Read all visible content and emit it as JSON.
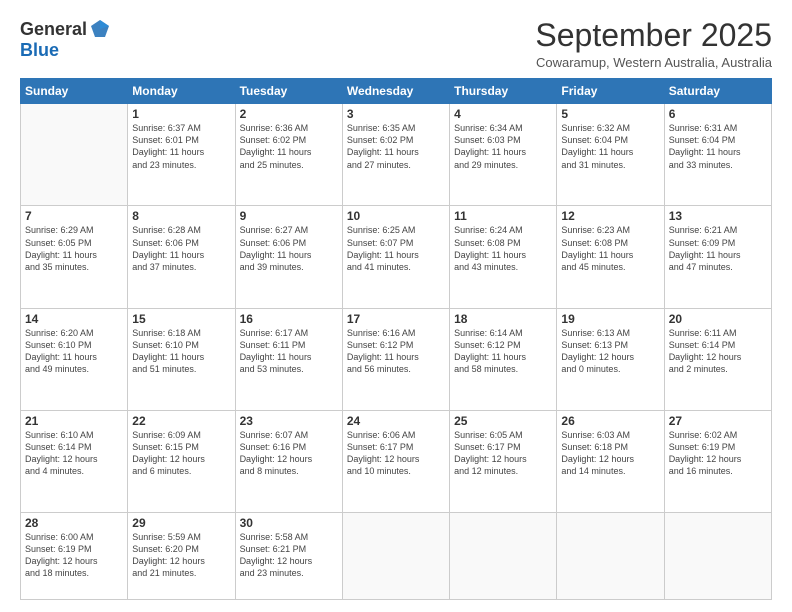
{
  "header": {
    "logo_general": "General",
    "logo_blue": "Blue",
    "month_title": "September 2025",
    "subtitle": "Cowaramup, Western Australia, Australia"
  },
  "days_of_week": [
    "Sunday",
    "Monday",
    "Tuesday",
    "Wednesday",
    "Thursday",
    "Friday",
    "Saturday"
  ],
  "weeks": [
    [
      {
        "day": "",
        "info": ""
      },
      {
        "day": "1",
        "info": "Sunrise: 6:37 AM\nSunset: 6:01 PM\nDaylight: 11 hours\nand 23 minutes."
      },
      {
        "day": "2",
        "info": "Sunrise: 6:36 AM\nSunset: 6:02 PM\nDaylight: 11 hours\nand 25 minutes."
      },
      {
        "day": "3",
        "info": "Sunrise: 6:35 AM\nSunset: 6:02 PM\nDaylight: 11 hours\nand 27 minutes."
      },
      {
        "day": "4",
        "info": "Sunrise: 6:34 AM\nSunset: 6:03 PM\nDaylight: 11 hours\nand 29 minutes."
      },
      {
        "day": "5",
        "info": "Sunrise: 6:32 AM\nSunset: 6:04 PM\nDaylight: 11 hours\nand 31 minutes."
      },
      {
        "day": "6",
        "info": "Sunrise: 6:31 AM\nSunset: 6:04 PM\nDaylight: 11 hours\nand 33 minutes."
      }
    ],
    [
      {
        "day": "7",
        "info": "Sunrise: 6:29 AM\nSunset: 6:05 PM\nDaylight: 11 hours\nand 35 minutes."
      },
      {
        "day": "8",
        "info": "Sunrise: 6:28 AM\nSunset: 6:06 PM\nDaylight: 11 hours\nand 37 minutes."
      },
      {
        "day": "9",
        "info": "Sunrise: 6:27 AM\nSunset: 6:06 PM\nDaylight: 11 hours\nand 39 minutes."
      },
      {
        "day": "10",
        "info": "Sunrise: 6:25 AM\nSunset: 6:07 PM\nDaylight: 11 hours\nand 41 minutes."
      },
      {
        "day": "11",
        "info": "Sunrise: 6:24 AM\nSunset: 6:08 PM\nDaylight: 11 hours\nand 43 minutes."
      },
      {
        "day": "12",
        "info": "Sunrise: 6:23 AM\nSunset: 6:08 PM\nDaylight: 11 hours\nand 45 minutes."
      },
      {
        "day": "13",
        "info": "Sunrise: 6:21 AM\nSunset: 6:09 PM\nDaylight: 11 hours\nand 47 minutes."
      }
    ],
    [
      {
        "day": "14",
        "info": "Sunrise: 6:20 AM\nSunset: 6:10 PM\nDaylight: 11 hours\nand 49 minutes."
      },
      {
        "day": "15",
        "info": "Sunrise: 6:18 AM\nSunset: 6:10 PM\nDaylight: 11 hours\nand 51 minutes."
      },
      {
        "day": "16",
        "info": "Sunrise: 6:17 AM\nSunset: 6:11 PM\nDaylight: 11 hours\nand 53 minutes."
      },
      {
        "day": "17",
        "info": "Sunrise: 6:16 AM\nSunset: 6:12 PM\nDaylight: 11 hours\nand 56 minutes."
      },
      {
        "day": "18",
        "info": "Sunrise: 6:14 AM\nSunset: 6:12 PM\nDaylight: 11 hours\nand 58 minutes."
      },
      {
        "day": "19",
        "info": "Sunrise: 6:13 AM\nSunset: 6:13 PM\nDaylight: 12 hours\nand 0 minutes."
      },
      {
        "day": "20",
        "info": "Sunrise: 6:11 AM\nSunset: 6:14 PM\nDaylight: 12 hours\nand 2 minutes."
      }
    ],
    [
      {
        "day": "21",
        "info": "Sunrise: 6:10 AM\nSunset: 6:14 PM\nDaylight: 12 hours\nand 4 minutes."
      },
      {
        "day": "22",
        "info": "Sunrise: 6:09 AM\nSunset: 6:15 PM\nDaylight: 12 hours\nand 6 minutes."
      },
      {
        "day": "23",
        "info": "Sunrise: 6:07 AM\nSunset: 6:16 PM\nDaylight: 12 hours\nand 8 minutes."
      },
      {
        "day": "24",
        "info": "Sunrise: 6:06 AM\nSunset: 6:17 PM\nDaylight: 12 hours\nand 10 minutes."
      },
      {
        "day": "25",
        "info": "Sunrise: 6:05 AM\nSunset: 6:17 PM\nDaylight: 12 hours\nand 12 minutes."
      },
      {
        "day": "26",
        "info": "Sunrise: 6:03 AM\nSunset: 6:18 PM\nDaylight: 12 hours\nand 14 minutes."
      },
      {
        "day": "27",
        "info": "Sunrise: 6:02 AM\nSunset: 6:19 PM\nDaylight: 12 hours\nand 16 minutes."
      }
    ],
    [
      {
        "day": "28",
        "info": "Sunrise: 6:00 AM\nSunset: 6:19 PM\nDaylight: 12 hours\nand 18 minutes."
      },
      {
        "day": "29",
        "info": "Sunrise: 5:59 AM\nSunset: 6:20 PM\nDaylight: 12 hours\nand 21 minutes."
      },
      {
        "day": "30",
        "info": "Sunrise: 5:58 AM\nSunset: 6:21 PM\nDaylight: 12 hours\nand 23 minutes."
      },
      {
        "day": "",
        "info": ""
      },
      {
        "day": "",
        "info": ""
      },
      {
        "day": "",
        "info": ""
      },
      {
        "day": "",
        "info": ""
      }
    ]
  ]
}
